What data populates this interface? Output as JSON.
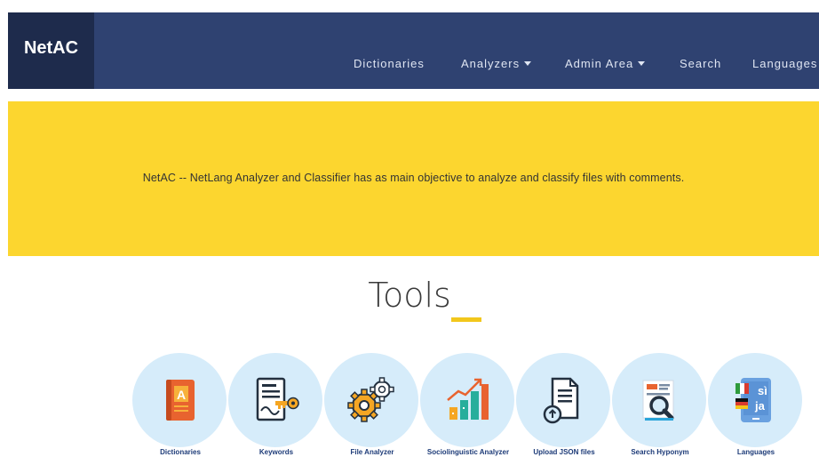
{
  "brand": "NetAC",
  "nav": {
    "dictionaries": "Dictionaries",
    "analyzers": "Analyzers",
    "admin_area": "Admin Area",
    "search": "Search",
    "languages": "Languages"
  },
  "banner": {
    "text": "NetAC -- NetLang Analyzer and Classifier has as main objective to analyze and classify files with comments."
  },
  "tools": {
    "title": "Tools",
    "items": [
      {
        "label": "Dictionaries",
        "icon": "book-icon"
      },
      {
        "label": "Keywords",
        "icon": "document-key-icon"
      },
      {
        "label": "File Analyzer",
        "icon": "gears-icon"
      },
      {
        "label": "Sociolinguistic Analyzer",
        "icon": "bar-chart-icon"
      },
      {
        "label": "Upload JSON files",
        "icon": "upload-document-icon"
      },
      {
        "label": "Search Hyponym",
        "icon": "magnifier-document-icon"
      },
      {
        "label": "Languages",
        "icon": "language-tablet-icon"
      }
    ]
  },
  "colors": {
    "navbar": "#2f4271",
    "brand_bg": "#1e2b4c",
    "banner": "#fcd62f",
    "accent": "#f2c71c",
    "tool_circle": "#d6ecfa",
    "tool_label": "#1d3b78"
  }
}
